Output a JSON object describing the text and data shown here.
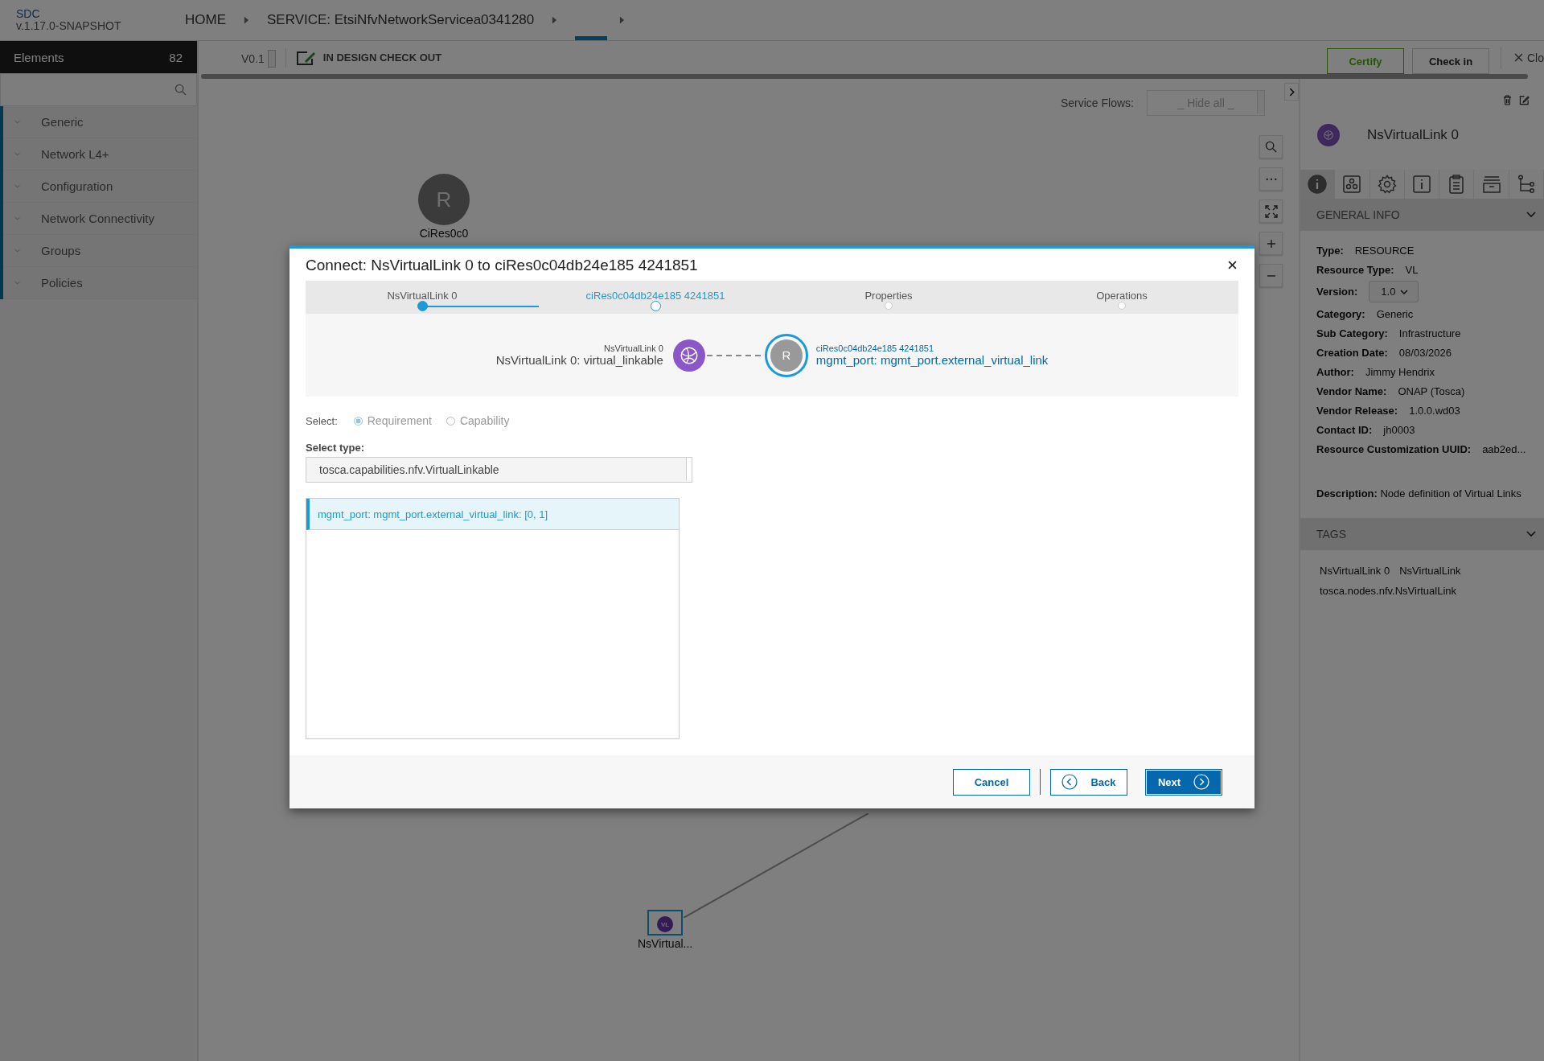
{
  "app": {
    "name": "SDC",
    "version": "v.1.17.0-SNAPSHOT"
  },
  "breadcrumbs": [
    {
      "label": "HOME"
    },
    {
      "label": "SERVICE: EtsiNfvNetworkServicea0341280"
    }
  ],
  "sidebar": {
    "title": "Elements",
    "count": "82",
    "items": [
      {
        "label": "Generic",
        "expanded": false
      },
      {
        "label": "Network L4+",
        "expanded": false
      },
      {
        "label": "Configuration",
        "expanded": false
      },
      {
        "label": "Network Connectivity",
        "expanded": false
      },
      {
        "label": "Groups",
        "expanded": false
      },
      {
        "label": "Policies",
        "expanded": false
      }
    ]
  },
  "toolbar": {
    "version": "V0.1",
    "status": "IN DESIGN CHECK OUT",
    "buttons": [
      {
        "label": "Certify",
        "kind": "certify"
      },
      {
        "label": "Check in",
        "kind": "plain"
      }
    ],
    "close": "Clo"
  },
  "canvas": {
    "service_flows": {
      "label": "Service Flows:",
      "value": "_ Hide all _"
    },
    "nodes": [
      {
        "kind": "resource",
        "icon": "R",
        "label": "CiRes0c0"
      },
      {
        "kind": "link",
        "icon": "VL",
        "label": "NsVirtual...",
        "selected": true
      }
    ]
  },
  "right_panel": {
    "title": "NsVirtualLink 0",
    "tabs": [
      {
        "kind": "info",
        "selected": true
      },
      {
        "kind": "composition",
        "selected": false
      },
      {
        "kind": "settings",
        "selected": false
      },
      {
        "kind": "details",
        "selected": false
      },
      {
        "kind": "clipboard",
        "selected": false
      },
      {
        "kind": "archive",
        "selected": false
      },
      {
        "kind": "tree",
        "selected": false
      }
    ],
    "general_info": {
      "title": "GENERAL INFO",
      "fields": [
        {
          "label": "Type:",
          "value": "RESOURCE"
        },
        {
          "label": "Resource Type:",
          "value": "VL"
        },
        {
          "label": "Version:",
          "value": "1.0",
          "kind": "dropdown"
        },
        {
          "label": "Category:",
          "value": "Generic"
        },
        {
          "label": "Sub Category:",
          "value": "Infrastructure"
        },
        {
          "label": "Creation Date:",
          "value": "08/03/2026"
        },
        {
          "label": "Author:",
          "value": "Jimmy Hendrix"
        },
        {
          "label": "Vendor Name:",
          "value": "ONAP (Tosca)"
        },
        {
          "label": "Vendor Release:",
          "value": "1.0.0.wd03"
        },
        {
          "label": "Contact ID:",
          "value": "jh0003"
        },
        {
          "label": "Resource Customization UUID:",
          "value": "aab2ed..."
        }
      ],
      "description": "**Description:** Node definition of Virtual Links"
    },
    "tags": {
      "title": "TAGS",
      "items": [
        {
          "label": "NsVirtualLink 0"
        },
        {
          "label": "NsVirtualLink"
        },
        {
          "label": "tosca.nodes.nfv.NsVirtualLink"
        }
      ]
    }
  },
  "modal": {
    "title": "Connect: NsVirtualLink 0 to ciRes0c04db24e185 4241851",
    "steps": [
      {
        "label": "NsVirtualLink 0",
        "selected": false,
        "completed": true
      },
      {
        "label": "ciRes0c04db24e185 4241851",
        "selected": true,
        "completed": false
      },
      {
        "label": "Properties",
        "selected": false,
        "completed": false
      },
      {
        "label": "Operations",
        "selected": false,
        "completed": false
      }
    ],
    "source": {
      "caption": "NsVirtualLink 0",
      "name": "NsVirtualLink 0: virtual_linkable"
    },
    "target": {
      "caption": "ciRes0c04db24e185 4241851",
      "name": "mgmt_port: mgmt_port.external_virtual_link",
      "icon": "R"
    },
    "select": {
      "label": "Select:",
      "options": [
        {
          "label": "Requirement",
          "selected": true,
          "disabled": true
        },
        {
          "label": "Capability",
          "selected": false,
          "disabled": true
        }
      ]
    },
    "select_type": {
      "label": "Select type:",
      "value": "tosca.capabilities.nfv.VirtualLinkable"
    },
    "list": [
      {
        "label": "mgmt_port: mgmt_port.external_virtual_link: [0, 1]",
        "selected": true
      }
    ],
    "buttons": [
      {
        "label": "Cancel",
        "kind": "cancel"
      },
      {
        "label": "Back",
        "kind": "back"
      },
      {
        "label": "Next",
        "kind": "next"
      }
    ]
  }
}
